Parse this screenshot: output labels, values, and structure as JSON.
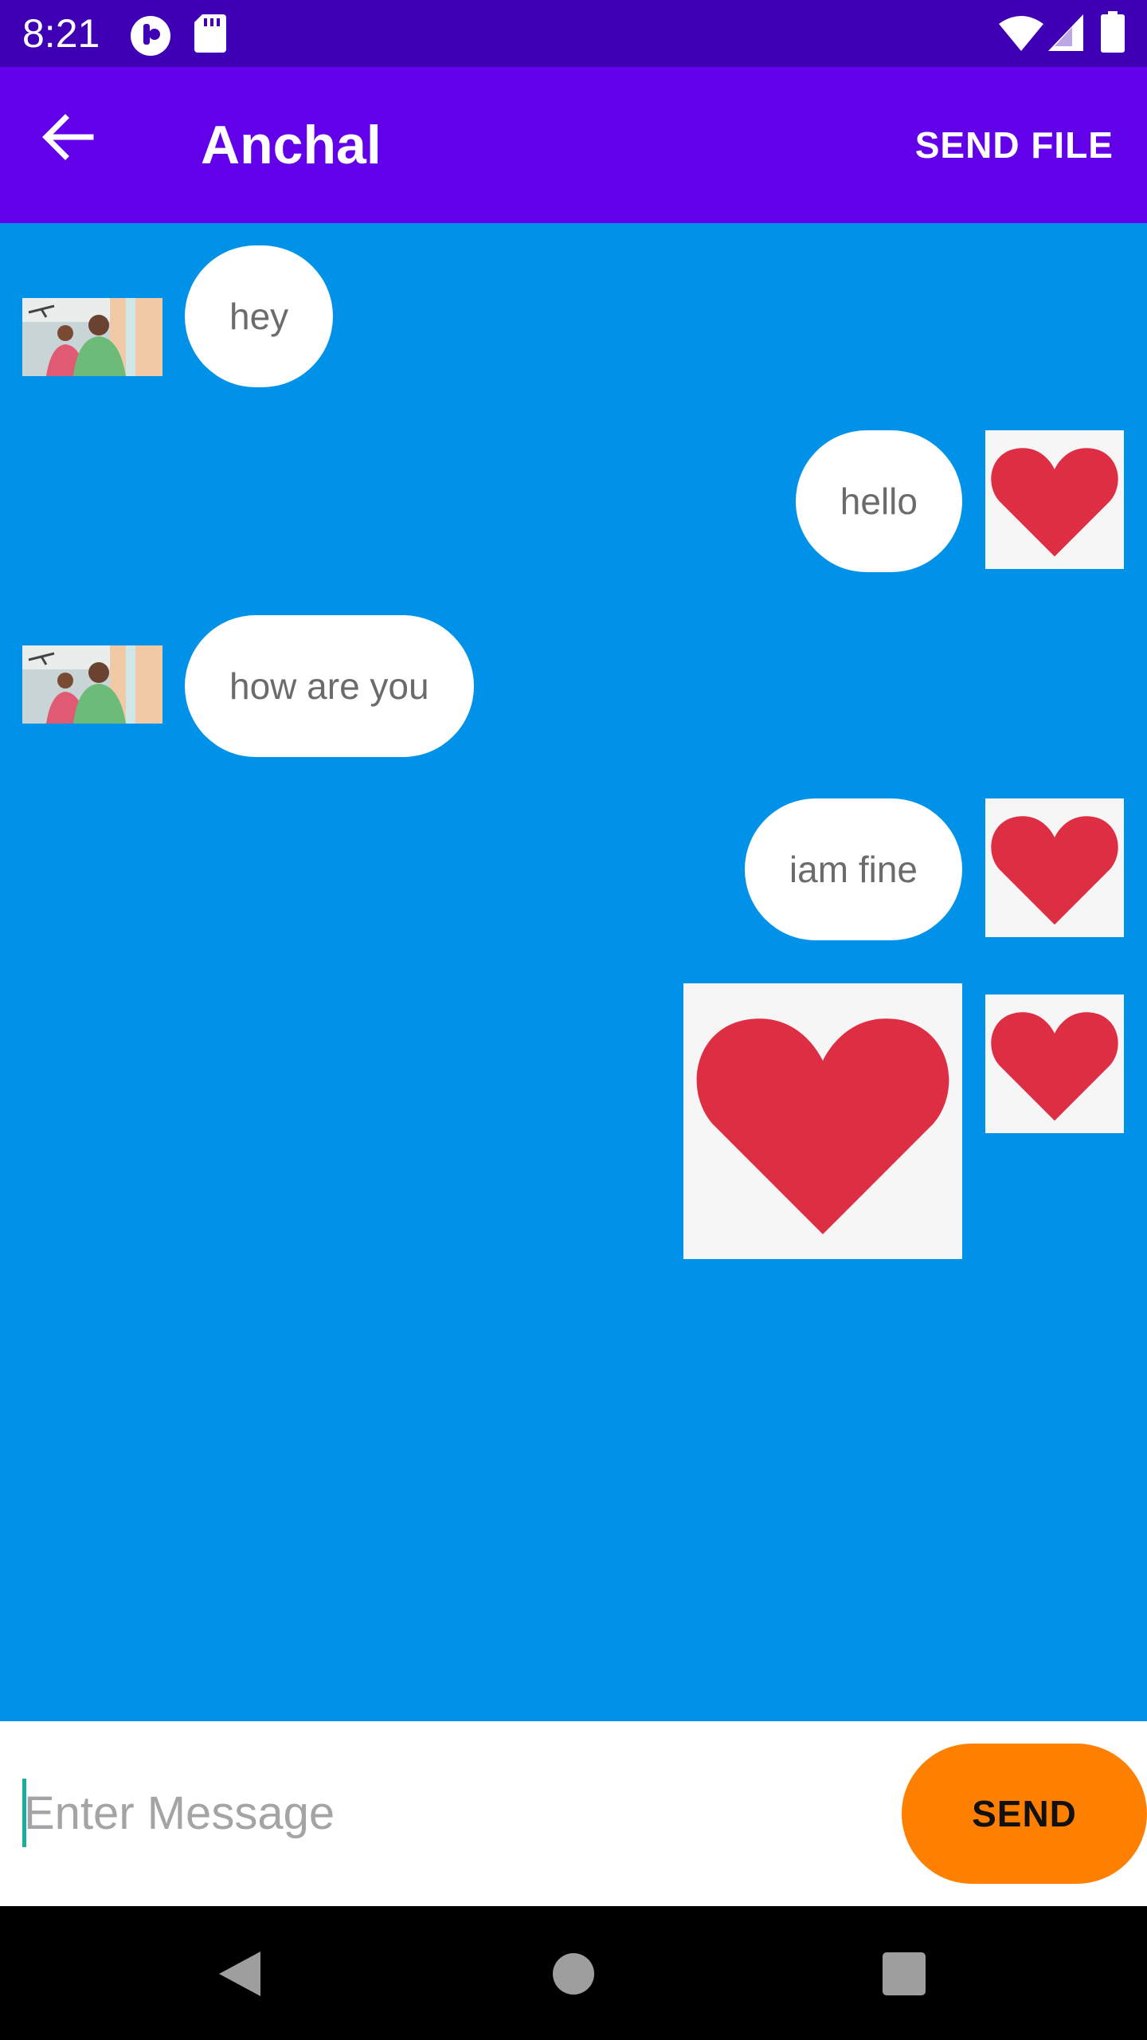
{
  "status_bar": {
    "time": "8:21",
    "left_icons": [
      "app-notification-icon",
      "sd-card-icon"
    ],
    "right_icons": [
      "wifi-icon",
      "cellular-signal-icon",
      "battery-icon"
    ]
  },
  "app_bar": {
    "back_icon": "arrow-back-icon",
    "title": "Anchal",
    "action_label": "SEND FILE"
  },
  "messages": [
    {
      "side": "received",
      "type": "text",
      "text": "hey",
      "avatar": "contact-photo"
    },
    {
      "side": "sent",
      "type": "text",
      "text": "hello",
      "avatar": "heart-icon"
    },
    {
      "side": "received",
      "type": "text",
      "text": "how are you",
      "avatar": "contact-photo"
    },
    {
      "side": "sent",
      "type": "text",
      "text": "iam fine",
      "avatar": "heart-icon"
    },
    {
      "side": "sent",
      "type": "image",
      "image": "heart-icon",
      "avatar": "heart-icon"
    }
  ],
  "input": {
    "placeholder": "Enter Message",
    "value": ""
  },
  "send_button": {
    "label": "SEND"
  },
  "nav_bar": {
    "icons": [
      "nav-back-icon",
      "nav-home-icon",
      "nav-recents-icon"
    ]
  },
  "colors": {
    "status_bar": "#3F00B5",
    "app_bar": "#6200EA",
    "chat_background": "#0092E8",
    "bubble": "#FFFFFF",
    "send_button": "#FF8000",
    "heart": "#DD2E44"
  }
}
